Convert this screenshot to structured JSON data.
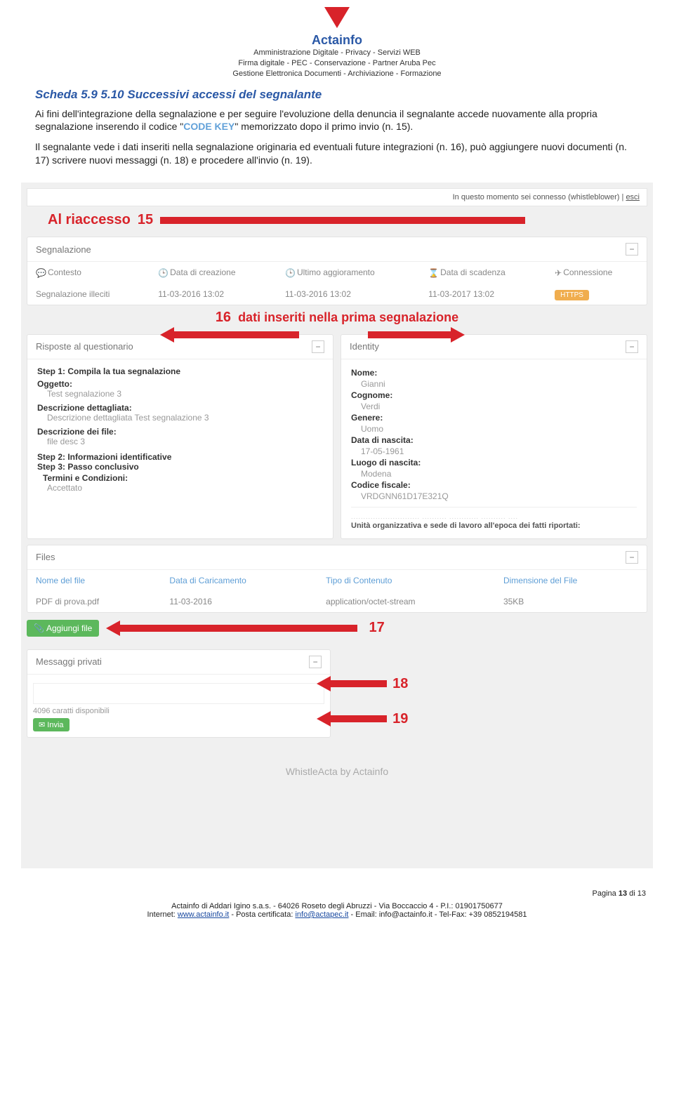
{
  "header": {
    "brand": "Actainfo",
    "tag1": "Amministrazione Digitale - Privacy - Servizi WEB",
    "tag2": "Firma digitale - PEC - Conservazione - Partner Aruba Pec",
    "tag3": "Gestione Elettronica Documenti - Archiviazione - Formazione"
  },
  "doc": {
    "heading": "Scheda 5.9 5.10 Successivi accessi del segnalante",
    "p1a": "Ai fini dell'integrazione della segnalazione e per seguire l'evoluzione della denuncia il segnalante accede nuovamente alla propria segnalazione inserendo il codice \"",
    "codekey": "CODE KEY",
    "p1b": "\" memorizzato dopo il primo invio (n. 15).",
    "p2": "Il segnalante vede i dati inseriti nella segnalazione originaria ed eventuali future integrazioni (n. 16), può aggiungere nuovi documenti (n. 17) scrivere nuovi messaggi (n. 18) e procedere all'invio (n. 19)."
  },
  "ann": {
    "riaccesso": "Al riaccesso",
    "n15": "15",
    "n16": "16",
    "dati": "dati inseriti nella prima segnalazione",
    "n17": "17",
    "n18": "18",
    "n19": "19"
  },
  "topbar": {
    "connected": "In questo momento sei connesso (whistleblower) |",
    "esci": "esci"
  },
  "segn": {
    "title": "Segnalazione",
    "h_contesto": "Contesto",
    "h_data_cre": "Data di creazione",
    "h_ultimo": "Ultimo aggioramento",
    "h_scad": "Data di scadenza",
    "h_conn": "Connessione",
    "r_contesto": "Segnalazione illeciti",
    "r_data_cre": "11-03-2016 13:02",
    "r_ultimo": "11-03-2016 13:02",
    "r_scad": "11-03-2017 13:02",
    "r_badge": "HTTPS"
  },
  "quest": {
    "title": "Risposte al questionario",
    "step1": "Step 1: Compila la tua segnalazione",
    "ogg_l": "Oggetto:",
    "ogg_v": "Test segnalazione 3",
    "desc_l": "Descrizione dettagliata:",
    "desc_v": "Descrizione dettagliata Test segnalazione 3",
    "file_l": "Descrizione dei file:",
    "file_v": "file desc 3",
    "step2": "Step 2: Informazioni identificative",
    "step3": "Step 3: Passo conclusivo",
    "term_l": "Termini e Condizioni:",
    "term_v": "Accettato"
  },
  "ident": {
    "title": "Identity",
    "nome_l": "Nome:",
    "nome_v": "Gianni",
    "cogn_l": "Cognome:",
    "cogn_v": "Verdi",
    "gen_l": "Genere:",
    "gen_v": "Uomo",
    "nasc_l": "Data di nascita:",
    "nasc_v": "17-05-1961",
    "luogo_l": "Luogo di nascita:",
    "luogo_v": "Modena",
    "cf_l": "Codice fiscale:",
    "cf_v": "VRDGNN61D17E321Q",
    "trunc2": "Unità organizzativa e sede di lavoro all'epoca dei fatti riportati:"
  },
  "files": {
    "title": "Files",
    "h_nome": "Nome del file",
    "h_data": "Data di Caricamento",
    "h_tipo": "Tipo di Contenuto",
    "h_dim": "Dimensione del File",
    "r_nome": "PDF di prova.pdf",
    "r_data": "11-03-2016",
    "r_tipo": "application/octet-stream",
    "r_dim": "35KB",
    "btn": "Aggiungi file"
  },
  "msg": {
    "title": "Messaggi privati",
    "chars": "4096 caratti disponibili",
    "send": "Invia"
  },
  "footerbrand": "WhistleActa by Actainfo",
  "pagefoot": {
    "pageno_a": "Pagina ",
    "pageno_b": "13",
    "pageno_c": " di 13",
    "line1": "Actainfo di Addari Igino s.a.s. - 64026 Roseto degli Abruzzi - Via Boccaccio 4 - P.I.: 01901750677",
    "line2a": "Internet: ",
    "url1": "www.actainfo.it",
    "line2b": " - Posta certificata: ",
    "url2": "info@actapec.it",
    "line2c": " - Email: info@actainfo.it - Tel-Fax: +39 0852194581"
  }
}
